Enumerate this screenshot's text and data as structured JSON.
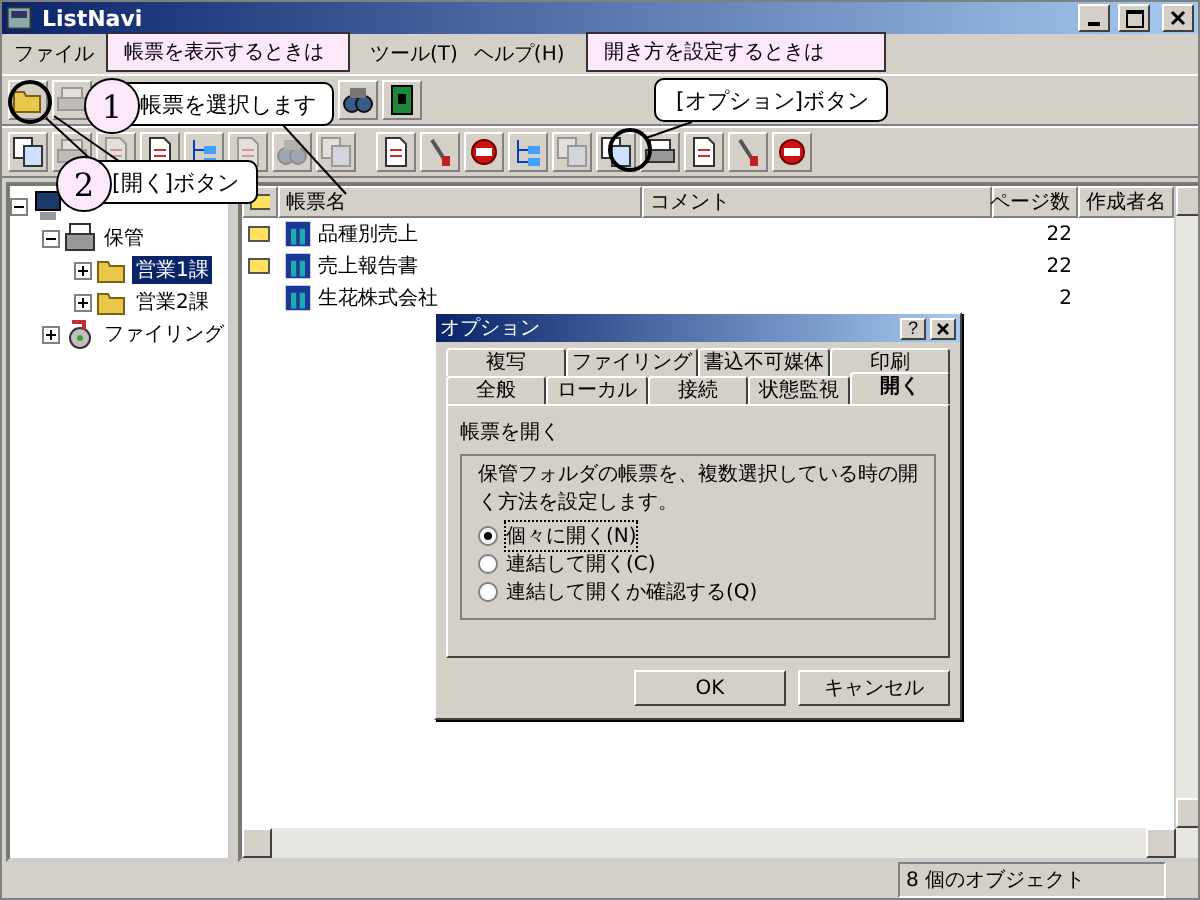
{
  "window": {
    "title": "ListNavi"
  },
  "menu": [
    "ファイル",
    "ツール(T)",
    "ヘルプ(H)"
  ],
  "toolbars": [
    {
      "groups": [
        [
          {
            "kind": "folder",
            "disabled": false
          },
          {
            "kind": "printer",
            "disabled": true
          }
        ],
        [
          {
            "kind": "binoculars",
            "disabled": false
          },
          {
            "kind": "book",
            "disabled": false
          }
        ]
      ]
    },
    {
      "groups": [
        [
          {
            "kind": "copy",
            "disabled": false
          },
          {
            "kind": "printer",
            "disabled": true
          },
          {
            "kind": "document",
            "disabled": true
          },
          {
            "kind": "document",
            "disabled": false
          },
          {
            "kind": "tree",
            "disabled": false
          },
          {
            "kind": "document",
            "disabled": true
          },
          {
            "kind": "binoculars",
            "disabled": true
          },
          {
            "kind": "copy",
            "disabled": true
          }
        ],
        [
          {
            "kind": "document",
            "disabled": false
          },
          {
            "kind": "tool",
            "disabled": false
          },
          {
            "kind": "stop",
            "disabled": false
          },
          {
            "kind": "tree",
            "disabled": false
          },
          {
            "kind": "copy",
            "disabled": true
          },
          {
            "kind": "copy",
            "disabled": false
          },
          {
            "kind": "printer",
            "disabled": false
          },
          {
            "kind": "document",
            "disabled": false
          },
          {
            "kind": "tool",
            "disabled": false
          },
          {
            "kind": "stop",
            "disabled": false
          }
        ]
      ]
    }
  ],
  "tree": [
    {
      "kind": "computer",
      "expanded": true,
      "children": [
        {
          "label": "保管",
          "kind": "cabinet",
          "expanded": true,
          "selected": false,
          "children": [
            {
              "label": "営業1課",
              "kind": "folder",
              "expanded": false,
              "selected": true
            },
            {
              "label": "営業2課",
              "kind": "folder",
              "expanded": false,
              "selected": false
            }
          ]
        },
        {
          "label": "ファイリング",
          "kind": "filing",
          "expanded": false,
          "selected": false
        }
      ]
    }
  ],
  "table": {
    "columns": [
      "帳票名",
      "コメント",
      "ページ数",
      "作成者名"
    ],
    "rows": [
      {
        "flagged": true,
        "name": "品種別売上",
        "pages": "22"
      },
      {
        "flagged": true,
        "name": "売上報告書",
        "pages": "22"
      },
      {
        "flagged": false,
        "name": "生花株式会社",
        "pages": "2"
      }
    ]
  },
  "status_bar": "8 個のオブジェクト",
  "dialog": {
    "title": "オプション",
    "help": "?",
    "tab_rows": [
      [
        {
          "label": "複写",
          "selected": false
        },
        {
          "label": "ファイリング",
          "selected": false
        },
        {
          "label": "書込不可媒体",
          "selected": false
        },
        {
          "label": "印刷",
          "selected": false
        }
      ],
      [
        {
          "label": "全般",
          "selected": false
        },
        {
          "label": "ローカル",
          "selected": false
        },
        {
          "label": "接続",
          "selected": false
        },
        {
          "label": "状態監視",
          "selected": false
        },
        {
          "label": "開く",
          "selected": true
        }
      ]
    ],
    "section": "帳票を開く",
    "group": "保管フォルダの帳票を、複数選択している時の開く方法を設定します。",
    "options": [
      {
        "label": "個々に開く(N)",
        "selected": true
      },
      {
        "label": "連結して開く(C)",
        "selected": false
      },
      {
        "label": "連結して開くか確認する(Q)",
        "selected": false
      }
    ],
    "buttons": [
      "OK",
      "キャンセル"
    ]
  },
  "banners": [
    "帳票を表示するときは",
    "開き方を設定するときは"
  ],
  "callouts": [
    {
      "number": "1",
      "text": "帳票を選択します"
    },
    {
      "number": "2",
      "text": "[開く]ボタン"
    },
    {
      "text": "[オプション]ボタン"
    }
  ]
}
